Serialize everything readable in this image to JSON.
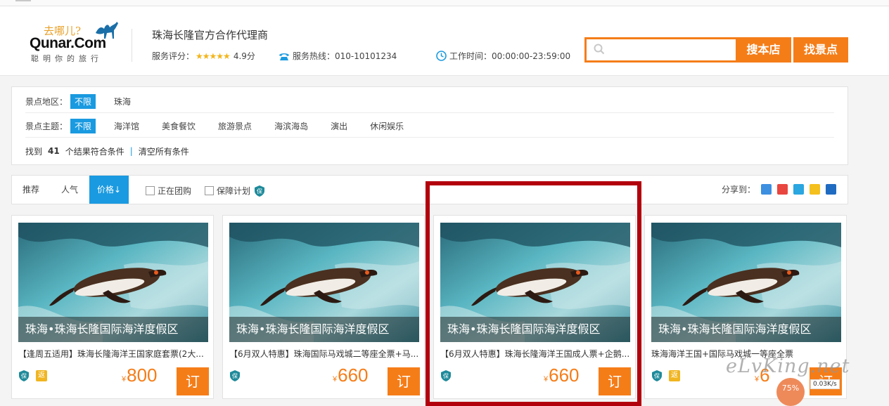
{
  "header": {
    "logo_qu": "去哪儿?",
    "logo_word": "Qunar.Com",
    "logo_slogan": "聪明你的旅行",
    "shop_name": "珠海长隆官方合作代理商",
    "rating_label": "服务评分：",
    "rating_stars": "★★★★★",
    "rating_value": "4.9分",
    "hotline": "服务热线：010-10101234",
    "worktime": "工作时间：00:00:00-23:59:00",
    "search_placeholder": "",
    "btn_search_shop": "搜本店",
    "btn_find_spot": "找景点"
  },
  "filters": {
    "area_label": "景点地区：",
    "area_options": [
      "不限",
      "珠海"
    ],
    "theme_label": "景点主题：",
    "theme_options": [
      "不限",
      "海洋馆",
      "美食餐饮",
      "旅游景点",
      "海滨海岛",
      "演出",
      "休闲娱乐"
    ],
    "result_prefix": "找到",
    "result_count": "41",
    "result_suffix": "个结果符合条件",
    "clear": "清空所有条件"
  },
  "sortbar": {
    "sorts": [
      "推荐",
      "人气",
      "价格"
    ],
    "active_sort": "价格",
    "price_arrow": "↓",
    "group_buy": "正在团购",
    "guarantee": "保障计划",
    "share_label": "分享到："
  },
  "cards": [
    {
      "caption": "珠海•珠海长隆国际海洋度假区",
      "desc": "【逢周五适用】珠海长隆海洋王国家庭套票(2大...",
      "currency": "¥",
      "price": "800",
      "order": "订",
      "badges": [
        "保",
        "返"
      ]
    },
    {
      "caption": "珠海•珠海长隆国际海洋度假区",
      "desc": "【6月双人特惠】珠海国际马戏城二等座全票+马...",
      "currency": "¥",
      "price": "660",
      "order": "订",
      "badges": [
        "保"
      ]
    },
    {
      "caption": "珠海•珠海长隆国际海洋度假区",
      "desc": "【6月双人特惠】珠海长隆海洋王国成人票+企鹅...",
      "currency": "¥",
      "price": "660",
      "order": "订",
      "badges": [
        "保"
      ]
    },
    {
      "caption": "珠海•珠海长隆国际海洋度假区",
      "desc": "珠海海洋王国+国际马戏城一等座全票",
      "currency": "¥",
      "price": "6",
      "order": "订",
      "badges": [
        "保",
        "返"
      ]
    }
  ],
  "watermark": "eLvKing.net",
  "widget": {
    "percent": "75%",
    "speed": "0.03K/s"
  },
  "colors": {
    "accent": "#f57d18",
    "blue": "#1a9ae0",
    "highlight_box": "#b3000d"
  }
}
